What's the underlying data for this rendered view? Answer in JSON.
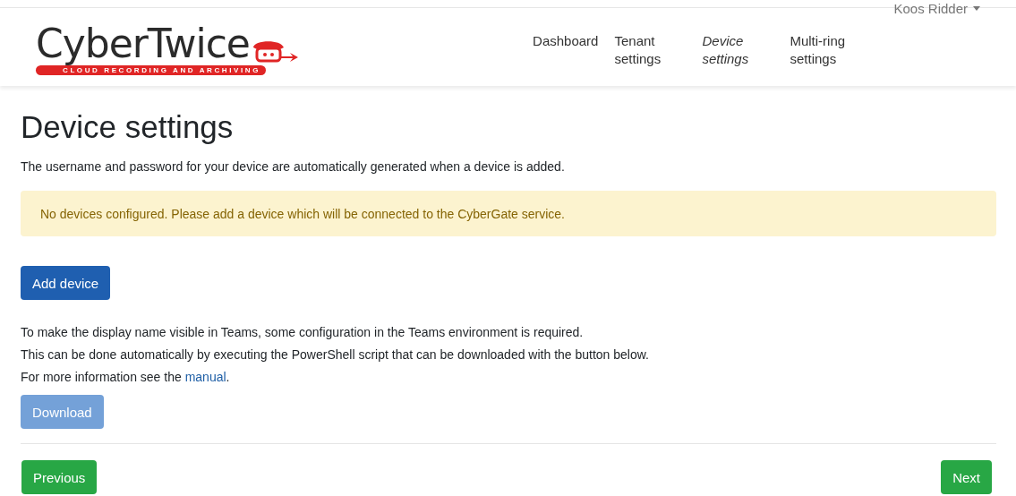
{
  "logo": {
    "name": "CyberTwice",
    "tagline": "CLOUD RECORDING AND ARCHIVING"
  },
  "nav": [
    {
      "label": "Dashboard",
      "selected": false
    },
    {
      "label": "Tenant settings",
      "selected": false
    },
    {
      "label": "Device settings",
      "selected": true
    },
    {
      "label": "Multi-ring settings",
      "selected": false
    }
  ],
  "user_menu": {
    "label": "Koos Ridder"
  },
  "title": "Device settings",
  "intro": "The username and password for your device are automatically generated when a device is added.",
  "alert": "No devices configured. Please add a device which will be connected to the CyberGate service.",
  "add_button": {
    "label": "Add device",
    "disabled": false
  },
  "info_lines": [
    "To make the display name visible in Teams, some configuration in the Teams environment is required.",
    "This can be done automatically by executing the PowerShell script that can be downloaded with the button below."
  ],
  "more_info": {
    "before": "For more information see the ",
    "link": "manual",
    "after": "."
  },
  "download_button": {
    "label": "Download",
    "disabled": true
  },
  "footer": {
    "previous": "Previous",
    "next": "Next"
  }
}
